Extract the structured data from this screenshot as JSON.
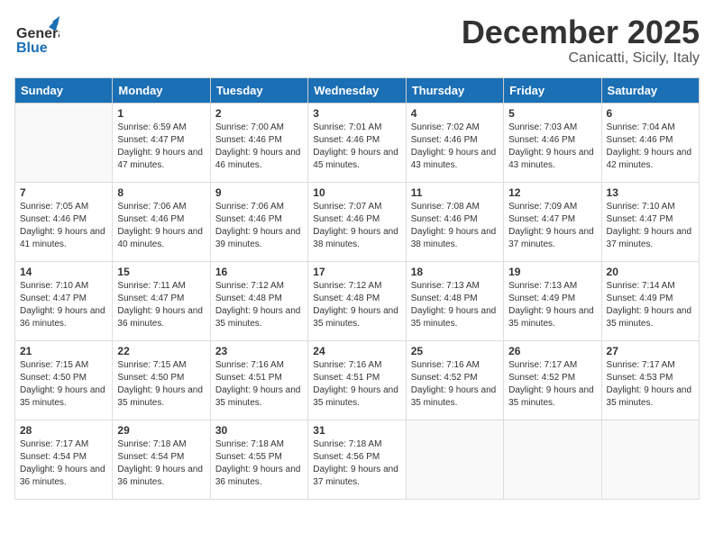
{
  "header": {
    "logo_general": "General",
    "logo_blue": "Blue",
    "month_title": "December 2025",
    "location": "Canicatti, Sicily, Italy"
  },
  "weekdays": [
    "Sunday",
    "Monday",
    "Tuesday",
    "Wednesday",
    "Thursday",
    "Friday",
    "Saturday"
  ],
  "weeks": [
    [
      {
        "day": "",
        "sunrise": "",
        "sunset": "",
        "daylight": ""
      },
      {
        "day": "1",
        "sunrise": "Sunrise: 6:59 AM",
        "sunset": "Sunset: 4:47 PM",
        "daylight": "Daylight: 9 hours and 47 minutes."
      },
      {
        "day": "2",
        "sunrise": "Sunrise: 7:00 AM",
        "sunset": "Sunset: 4:46 PM",
        "daylight": "Daylight: 9 hours and 46 minutes."
      },
      {
        "day": "3",
        "sunrise": "Sunrise: 7:01 AM",
        "sunset": "Sunset: 4:46 PM",
        "daylight": "Daylight: 9 hours and 45 minutes."
      },
      {
        "day": "4",
        "sunrise": "Sunrise: 7:02 AM",
        "sunset": "Sunset: 4:46 PM",
        "daylight": "Daylight: 9 hours and 43 minutes."
      },
      {
        "day": "5",
        "sunrise": "Sunrise: 7:03 AM",
        "sunset": "Sunset: 4:46 PM",
        "daylight": "Daylight: 9 hours and 43 minutes."
      },
      {
        "day": "6",
        "sunrise": "Sunrise: 7:04 AM",
        "sunset": "Sunset: 4:46 PM",
        "daylight": "Daylight: 9 hours and 42 minutes."
      }
    ],
    [
      {
        "day": "7",
        "sunrise": "Sunrise: 7:05 AM",
        "sunset": "Sunset: 4:46 PM",
        "daylight": "Daylight: 9 hours and 41 minutes."
      },
      {
        "day": "8",
        "sunrise": "Sunrise: 7:06 AM",
        "sunset": "Sunset: 4:46 PM",
        "daylight": "Daylight: 9 hours and 40 minutes."
      },
      {
        "day": "9",
        "sunrise": "Sunrise: 7:06 AM",
        "sunset": "Sunset: 4:46 PM",
        "daylight": "Daylight: 9 hours and 39 minutes."
      },
      {
        "day": "10",
        "sunrise": "Sunrise: 7:07 AM",
        "sunset": "Sunset: 4:46 PM",
        "daylight": "Daylight: 9 hours and 38 minutes."
      },
      {
        "day": "11",
        "sunrise": "Sunrise: 7:08 AM",
        "sunset": "Sunset: 4:46 PM",
        "daylight": "Daylight: 9 hours and 38 minutes."
      },
      {
        "day": "12",
        "sunrise": "Sunrise: 7:09 AM",
        "sunset": "Sunset: 4:47 PM",
        "daylight": "Daylight: 9 hours and 37 minutes."
      },
      {
        "day": "13",
        "sunrise": "Sunrise: 7:10 AM",
        "sunset": "Sunset: 4:47 PM",
        "daylight": "Daylight: 9 hours and 37 minutes."
      }
    ],
    [
      {
        "day": "14",
        "sunrise": "Sunrise: 7:10 AM",
        "sunset": "Sunset: 4:47 PM",
        "daylight": "Daylight: 9 hours and 36 minutes."
      },
      {
        "day": "15",
        "sunrise": "Sunrise: 7:11 AM",
        "sunset": "Sunset: 4:47 PM",
        "daylight": "Daylight: 9 hours and 36 minutes."
      },
      {
        "day": "16",
        "sunrise": "Sunrise: 7:12 AM",
        "sunset": "Sunset: 4:48 PM",
        "daylight": "Daylight: 9 hours and 35 minutes."
      },
      {
        "day": "17",
        "sunrise": "Sunrise: 7:12 AM",
        "sunset": "Sunset: 4:48 PM",
        "daylight": "Daylight: 9 hours and 35 minutes."
      },
      {
        "day": "18",
        "sunrise": "Sunrise: 7:13 AM",
        "sunset": "Sunset: 4:48 PM",
        "daylight": "Daylight: 9 hours and 35 minutes."
      },
      {
        "day": "19",
        "sunrise": "Sunrise: 7:13 AM",
        "sunset": "Sunset: 4:49 PM",
        "daylight": "Daylight: 9 hours and 35 minutes."
      },
      {
        "day": "20",
        "sunrise": "Sunrise: 7:14 AM",
        "sunset": "Sunset: 4:49 PM",
        "daylight": "Daylight: 9 hours and 35 minutes."
      }
    ],
    [
      {
        "day": "21",
        "sunrise": "Sunrise: 7:15 AM",
        "sunset": "Sunset: 4:50 PM",
        "daylight": "Daylight: 9 hours and 35 minutes."
      },
      {
        "day": "22",
        "sunrise": "Sunrise: 7:15 AM",
        "sunset": "Sunset: 4:50 PM",
        "daylight": "Daylight: 9 hours and 35 minutes."
      },
      {
        "day": "23",
        "sunrise": "Sunrise: 7:16 AM",
        "sunset": "Sunset: 4:51 PM",
        "daylight": "Daylight: 9 hours and 35 minutes."
      },
      {
        "day": "24",
        "sunrise": "Sunrise: 7:16 AM",
        "sunset": "Sunset: 4:51 PM",
        "daylight": "Daylight: 9 hours and 35 minutes."
      },
      {
        "day": "25",
        "sunrise": "Sunrise: 7:16 AM",
        "sunset": "Sunset: 4:52 PM",
        "daylight": "Daylight: 9 hours and 35 minutes."
      },
      {
        "day": "26",
        "sunrise": "Sunrise: 7:17 AM",
        "sunset": "Sunset: 4:52 PM",
        "daylight": "Daylight: 9 hours and 35 minutes."
      },
      {
        "day": "27",
        "sunrise": "Sunrise: 7:17 AM",
        "sunset": "Sunset: 4:53 PM",
        "daylight": "Daylight: 9 hours and 35 minutes."
      }
    ],
    [
      {
        "day": "28",
        "sunrise": "Sunrise: 7:17 AM",
        "sunset": "Sunset: 4:54 PM",
        "daylight": "Daylight: 9 hours and 36 minutes."
      },
      {
        "day": "29",
        "sunrise": "Sunrise: 7:18 AM",
        "sunset": "Sunset: 4:54 PM",
        "daylight": "Daylight: 9 hours and 36 minutes."
      },
      {
        "day": "30",
        "sunrise": "Sunrise: 7:18 AM",
        "sunset": "Sunset: 4:55 PM",
        "daylight": "Daylight: 9 hours and 36 minutes."
      },
      {
        "day": "31",
        "sunrise": "Sunrise: 7:18 AM",
        "sunset": "Sunset: 4:56 PM",
        "daylight": "Daylight: 9 hours and 37 minutes."
      },
      {
        "day": "",
        "sunrise": "",
        "sunset": "",
        "daylight": ""
      },
      {
        "day": "",
        "sunrise": "",
        "sunset": "",
        "daylight": ""
      },
      {
        "day": "",
        "sunrise": "",
        "sunset": "",
        "daylight": ""
      }
    ]
  ]
}
